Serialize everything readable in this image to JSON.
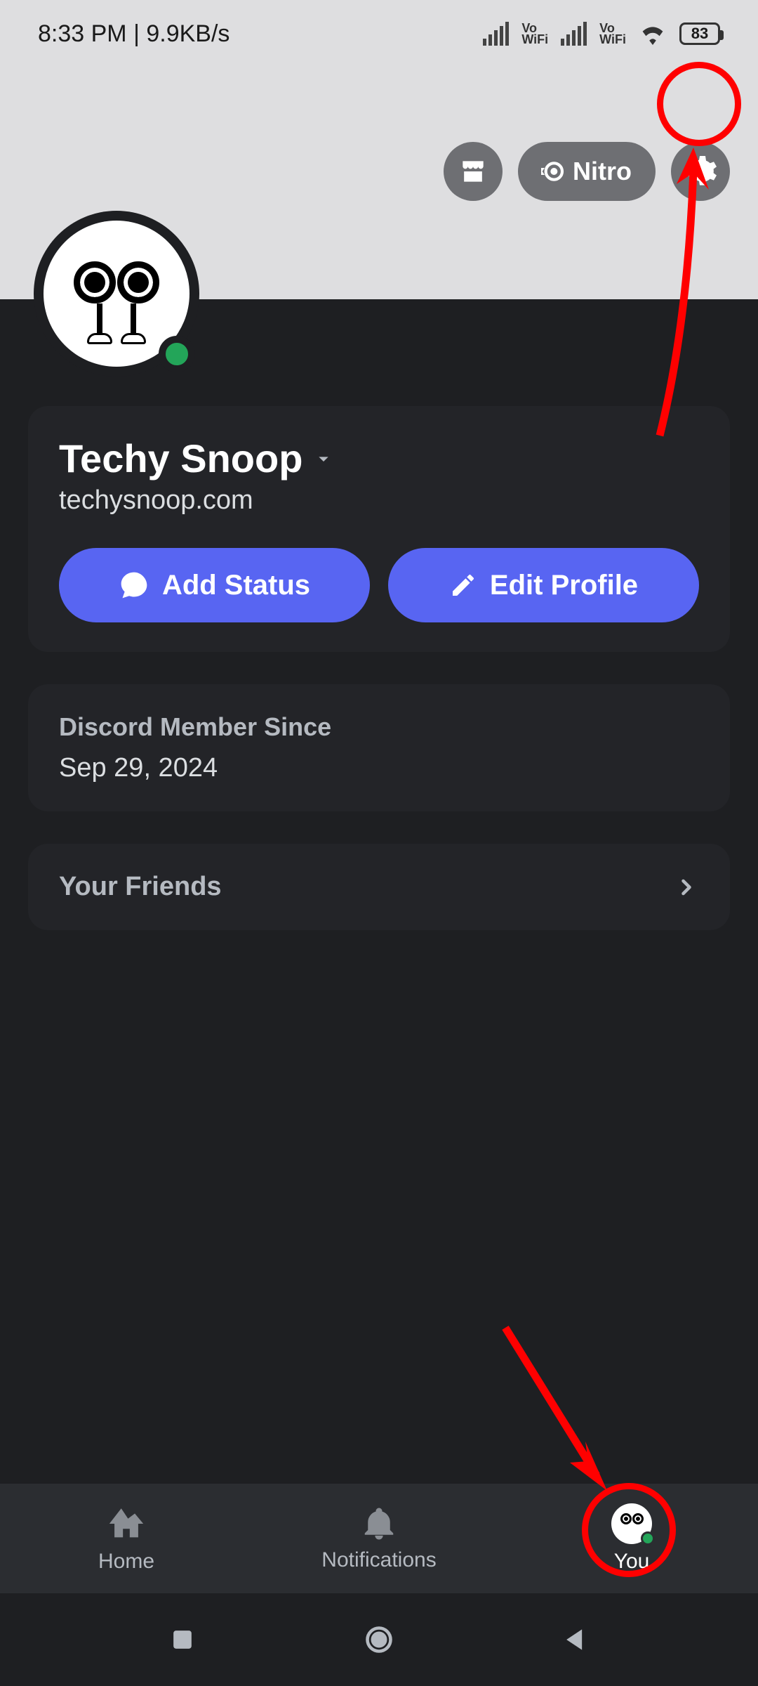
{
  "status_bar": {
    "time_text": "8:33 PM | 9.9KB/s",
    "battery_pct": "83"
  },
  "header": {
    "nitro_label": "Nitro"
  },
  "profile": {
    "display_name": "Techy Snoop",
    "username": "techysnoop.com",
    "add_status_label": "Add Status",
    "edit_profile_label": "Edit Profile"
  },
  "member_since": {
    "title": "Discord Member Since",
    "date": "Sep 29, 2024"
  },
  "friends": {
    "label": "Your Friends"
  },
  "bottom_nav": {
    "home": "Home",
    "notifications": "Notifications",
    "you": "You"
  },
  "colors": {
    "blurple": "#5865f2",
    "online": "#23a559",
    "annotation": "#ff0000"
  }
}
